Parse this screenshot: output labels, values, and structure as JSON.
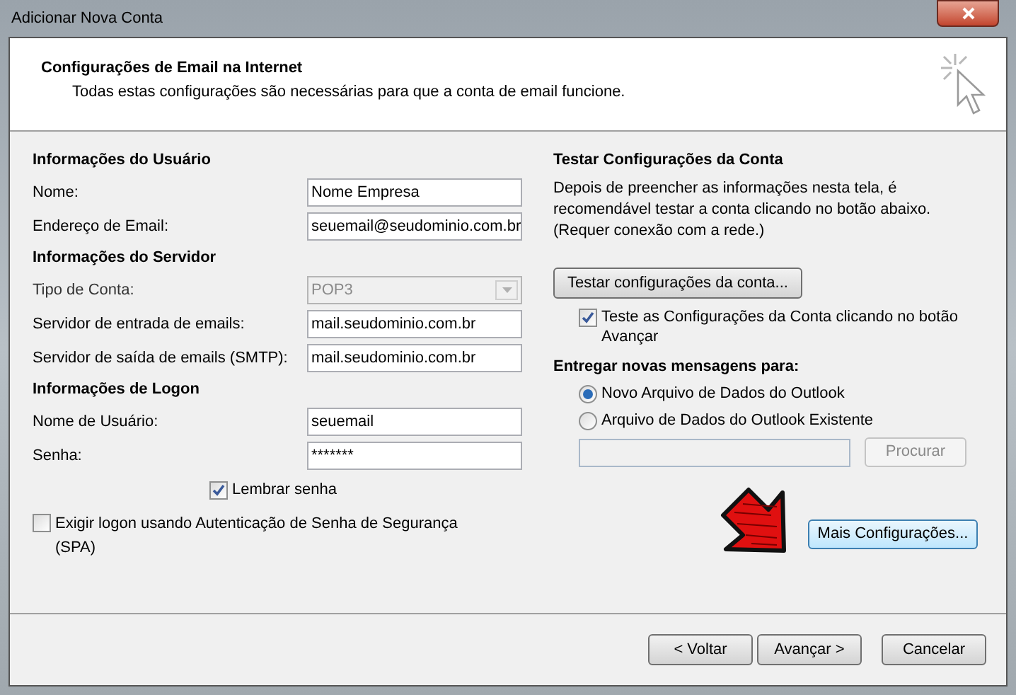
{
  "window": {
    "title": "Adicionar Nova Conta"
  },
  "header": {
    "title": "Configurações de Email na Internet",
    "subtitle": "Todas estas configurações são necessárias para que a conta de email funcione."
  },
  "left_sections": [
    {
      "heading": "Informações do Usuário",
      "fields": [
        {
          "kind": "text",
          "label": "Nome:",
          "value": "Nome Empresa",
          "disabled": false
        },
        {
          "kind": "text",
          "label": "Endereço de Email:",
          "value": "seuemail@seudominio.com.br",
          "disabled": false
        }
      ]
    },
    {
      "heading": "Informações do Servidor",
      "fields": [
        {
          "kind": "dropdown",
          "label": "Tipo de Conta:",
          "value": "POP3",
          "disabled": true
        },
        {
          "kind": "text",
          "label": "Servidor de entrada de emails:",
          "value": "mail.seudominio.com.br",
          "disabled": false
        },
        {
          "kind": "text",
          "label": "Servidor de saída de emails (SMTP):",
          "value": "mail.seudominio.com.br",
          "disabled": false
        }
      ]
    },
    {
      "heading": "Informações de Logon",
      "fields": [
        {
          "kind": "text",
          "label": "Nome de Usuário:",
          "value": "seuemail",
          "disabled": false
        },
        {
          "kind": "text",
          "label": "Senha:",
          "value": "*******",
          "disabled": false
        }
      ]
    }
  ],
  "remember_password": {
    "label": "Lembrar senha",
    "checked": true
  },
  "spa": {
    "label": "Exigir logon usando Autenticação de Senha de Segurança (SPA)",
    "checked": false
  },
  "test": {
    "heading": "Testar Configurações da Conta",
    "description": "Depois de preencher as informações nesta tela, é recomendável testar a conta clicando no botão abaixo. (Requer conexão com a rede.)",
    "button": "Testar configurações da conta...",
    "checkbox": {
      "label": "Teste as Configurações da Conta clicando no botão Avançar",
      "checked": true
    }
  },
  "delivery": {
    "heading": "Entregar novas mensagens para:",
    "options": [
      {
        "label": "Novo Arquivo de Dados do Outlook",
        "selected": true
      },
      {
        "label": "Arquivo de Dados do Outlook Existente",
        "selected": false
      }
    ],
    "browse_button": {
      "label": "Procurar",
      "disabled": true
    }
  },
  "more_settings_button": "Mais Configurações...",
  "footer_buttons": [
    {
      "label": "< Voltar"
    },
    {
      "label": "Avançar >"
    },
    {
      "label": "Cancelar"
    }
  ]
}
